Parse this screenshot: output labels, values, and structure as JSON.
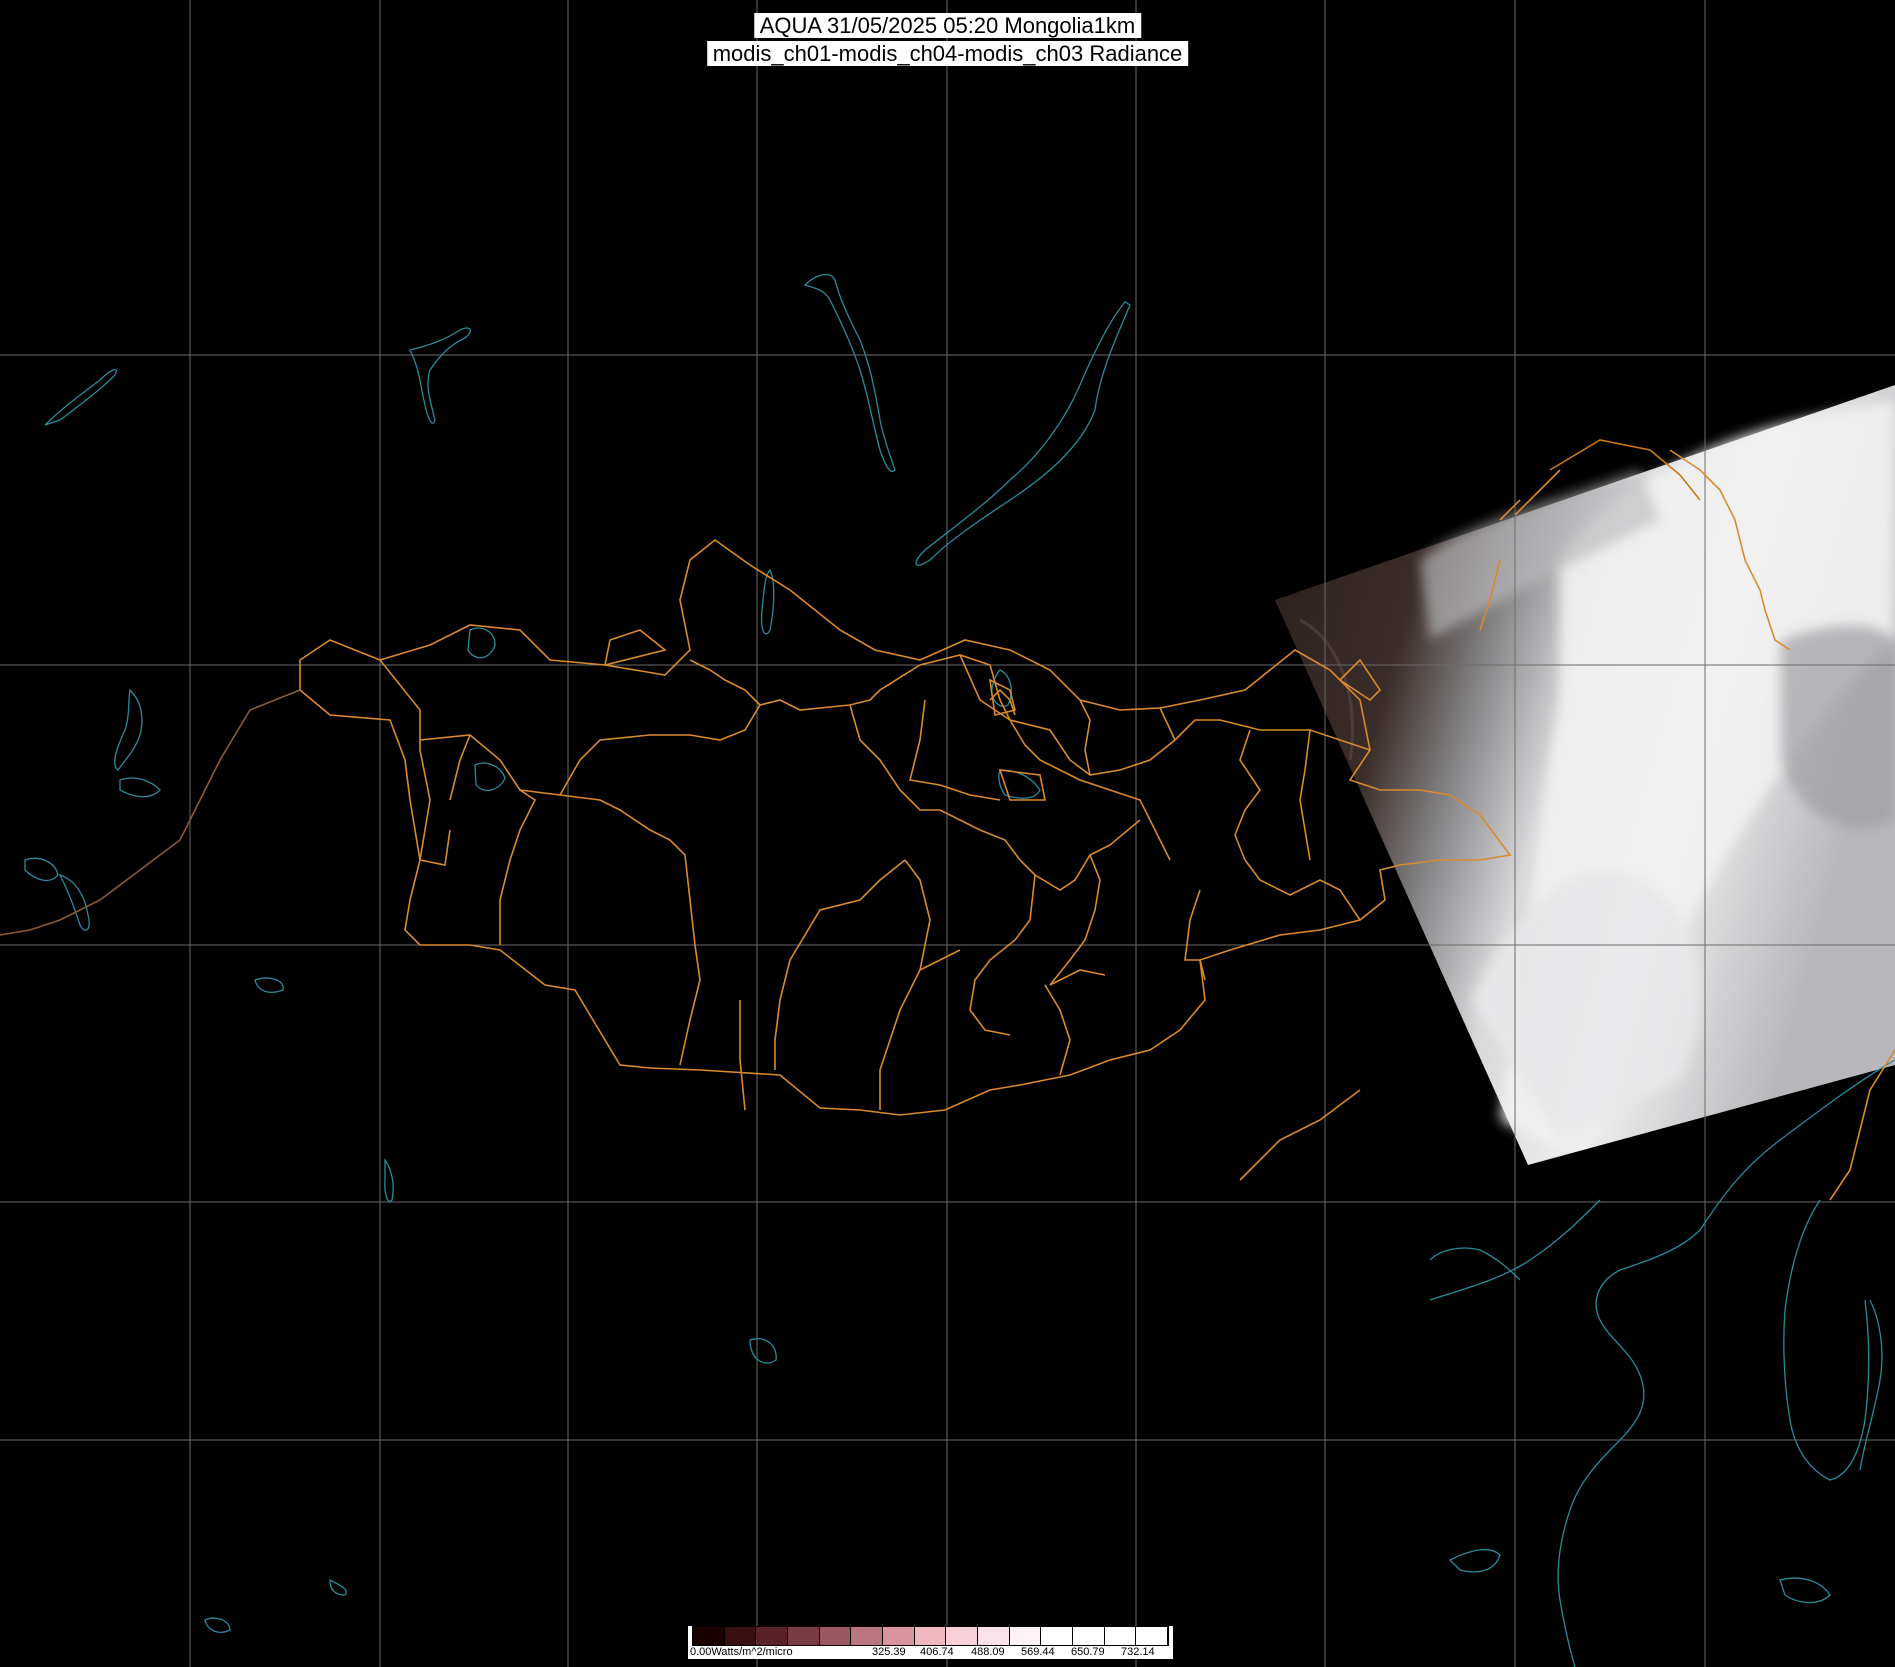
{
  "title": {
    "line1": "AQUA 31/05/2025 05:20 Mongolia1km",
    "line2": "modis_ch01-modis_ch04-modis_ch03 Radiance"
  },
  "colorbar": {
    "min_label": "0.00Watts/m^2/micro",
    "tick_labels": [
      "325.39",
      "406.74",
      "488.09",
      "569.44",
      "650.79",
      "732.14"
    ],
    "colors": [
      "#1a0000",
      "#3a0f12",
      "#5a2228",
      "#7a3c44",
      "#9a5862",
      "#b97680",
      "#d9959f",
      "#f0b7c0",
      "#f7cfd8",
      "#fbe2ea",
      "#fff2f7",
      "#ffffff",
      "#ffffff",
      "#ffffff",
      "#ffffff"
    ]
  },
  "map": {
    "background": "#000000",
    "gridline_color": "#6a6a6a",
    "admin_border_color": "#d98a2e",
    "coastline_color": "#2a8a9a",
    "satellite_swath": "visible cloud imagery over eastern Mongolia / northeast China"
  }
}
